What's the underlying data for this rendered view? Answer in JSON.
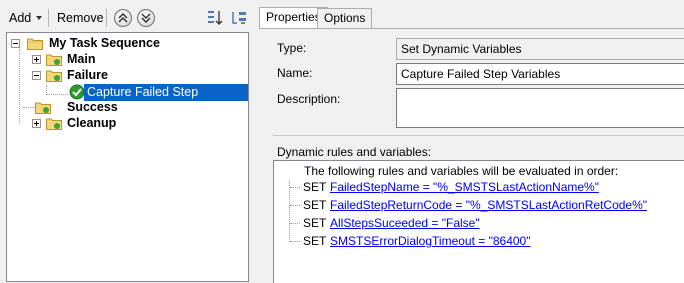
{
  "toolbar": {
    "add_label": "Add",
    "remove_label": "Remove"
  },
  "tree": {
    "root": "My Task Sequence",
    "groups": [
      {
        "label": "Main"
      },
      {
        "label": "Failure"
      },
      {
        "label": "Success"
      },
      {
        "label": "Cleanup"
      }
    ],
    "selected_step": "Capture Failed Step Variables"
  },
  "tabs": [
    {
      "label": "Properties",
      "active": true
    },
    {
      "label": "Options",
      "active": false
    }
  ],
  "properties": {
    "type_label": "Type:",
    "type_value": "Set Dynamic Variables",
    "name_label": "Name:",
    "name_value": "Capture Failed Step Variables",
    "description_label": "Description:",
    "description_value": ""
  },
  "rules": {
    "section_label": "Dynamic rules and variables:",
    "header": "The following rules and variables will be evaluated in order:",
    "items": [
      {
        "keyword": "SET",
        "text": "FailedStepName = \"%_SMSTSLastActionName%\""
      },
      {
        "keyword": "SET",
        "text": "FailedStepReturnCode = \"%_SMSTSLastActionRetCode%\""
      },
      {
        "keyword": "SET",
        "text": "AllStepsSuceeded = \"False\""
      },
      {
        "keyword": "SET",
        "text": "SMSTSErrorDialogTimeout = \"86400\""
      }
    ]
  },
  "icons": {
    "folder": "folder-icon",
    "check": "green-check-icon",
    "move_up": "move-up-icon",
    "move_down": "move-down-icon"
  },
  "colors": {
    "selection": "#0a64c8",
    "link": "#0000ee",
    "check_green": "#2e9a2e"
  }
}
